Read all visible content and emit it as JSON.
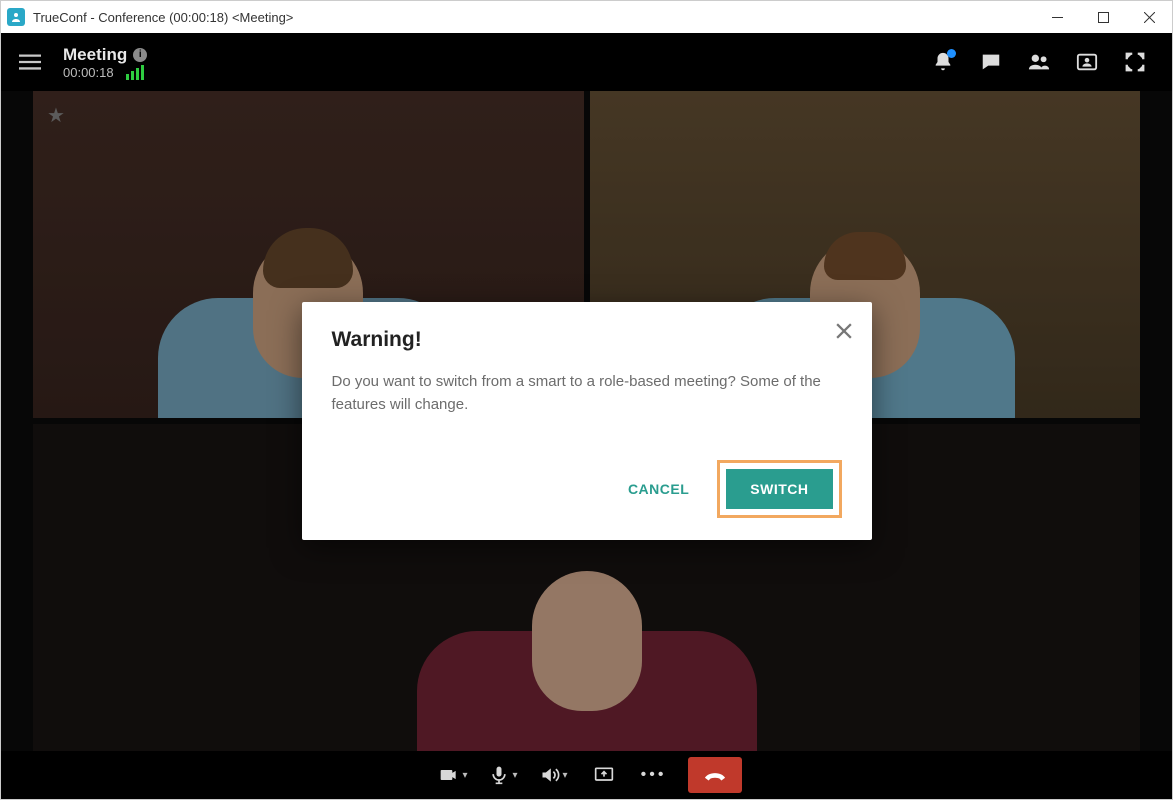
{
  "window": {
    "title": "TrueConf - Conference (00:00:18) <Meeting>"
  },
  "header": {
    "meeting_label": "Meeting",
    "elapsed": "00:00:18"
  },
  "dialog": {
    "title": "Warning!",
    "body": "Do you want to switch from a smart to a role-based meeting? Some of the features will change.",
    "cancel_label": "CANCEL",
    "switch_label": "SWITCH"
  },
  "colors": {
    "accent": "#2a9d8f",
    "highlight_border": "#f2a85f",
    "hangup": "#c0392b"
  },
  "icons": {
    "info": "i",
    "star": "★"
  }
}
